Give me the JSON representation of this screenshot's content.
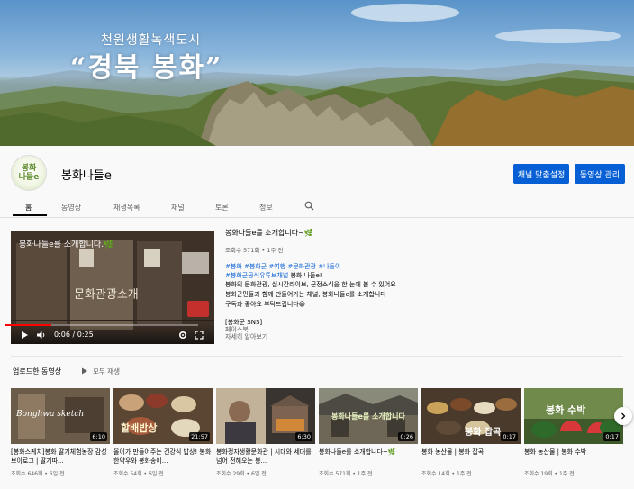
{
  "banner": {
    "subtitle": "천원생활녹색도시",
    "title": "“경북 봉화”"
  },
  "channel": {
    "avatar_text": "봉화\n나들e",
    "name": "봉화나들e",
    "customize_label": "채널 맞춤설정",
    "manage_label": "동영상 관리"
  },
  "tabs": [
    "홈",
    "동영상",
    "재생목록",
    "채널",
    "토론",
    "정보"
  ],
  "featured": {
    "player_title": "봉화나들e를 소개합니다.🌿",
    "center_text": "문화관광소개",
    "time": "0:06 / 0:25",
    "progress": 0.24,
    "title": "봉화나들e를 소개합니다~🌿",
    "meta": "조회수 571회 • 1주 전",
    "tags1": "#봉화 #봉화군 #여행 #문화관광 #나들이",
    "tags2": "#봉화군공식유튜브채널",
    "tags2_suffix": " 봉화 나들e!",
    "line1": "봉화의 문화관광, 실시간라이브, 군정소식을 한 눈에 볼 수 있어요",
    "line2": "봉화군민들과 함께 만들어가는 채널, 봉화나들e를 소개합니다",
    "line3": "구독과 좋아요 부탁드립니다😀",
    "line4": "[봉화군 SNS]",
    "line5": "페이스북",
    "more": "자세히 알아보기"
  },
  "uploads": {
    "title": "업로드한 동영상",
    "play_all": "모두 재생",
    "videos": [
      {
        "thumb_text": "Bonghwa sketch",
        "duration": "6:10",
        "title": "[봉화스케치]봉화 딸기체험농장 감성 브이로그 | 딸기따...",
        "meta": "조회수 646회 • 6일 전"
      },
      {
        "thumb_text": "할배밥상",
        "duration": "21:57",
        "title": "올이가 만들어주는 건강식 밥상! 봉화 한약우와 봉화송이...",
        "meta": "조회수 54회 • 6일 전"
      },
      {
        "thumb_text": "",
        "duration": "6:30",
        "title": "봉화정자생활문화관 | 시대와 세대를 넘어 전해오는 봉...",
        "meta": "조회수 29회 • 6일 전"
      },
      {
        "thumb_text": "봉화나들e를 소개합니다",
        "duration": "0:26",
        "title": "봉화나들e를 소개합니다~🌿",
        "meta": "조회수 571회 • 1주 전"
      },
      {
        "thumb_text": "봉화 잡곡",
        "duration": "0:17",
        "title": "봉화 농산물 | 봉화 잡곡",
        "meta": "조회수 14회 • 1주 전"
      },
      {
        "thumb_text": "봉화 수박",
        "duration": "0:17",
        "title": "봉화 농산물 | 봉화 수박",
        "meta": "조회수 19회 • 1주 전"
      }
    ]
  }
}
